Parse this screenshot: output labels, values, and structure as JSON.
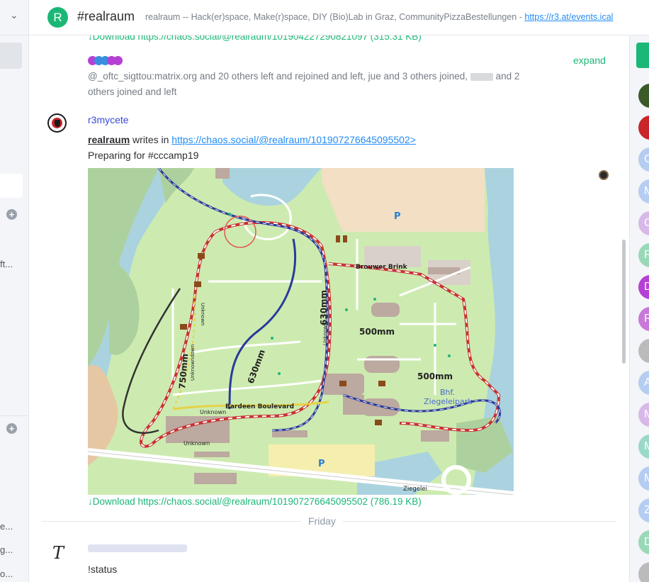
{
  "header": {
    "room_initial": "R",
    "room_name": "#realraum",
    "topic": "realraum -- Hack(er)space, Make(r)space, DIY (Bio)Lab in Graz, CommunityPizzaBestellungen - ",
    "topic_link": "https://r3.at/events.ical"
  },
  "left_panel": {
    "fragments": [
      "ft...",
      "e...",
      "g...",
      "o..."
    ]
  },
  "timeline": {
    "download_top": "↓Download https://chaos.social/@realraum/101904227290821097 (315.31 KB)",
    "expand_label": "expand",
    "membership_part1": "@_oftc_sigttou:matrix.org and 20 others left and rejoined and left, jue and 3 others joined, ",
    "membership_part2": "and 2 others joined and left",
    "pill_colors": [
      "#b640d6",
      "#3a8ee0",
      "#3a8ee0",
      "#b640d6",
      "#b640d6"
    ],
    "message": {
      "sender": "r3mycete",
      "quote_author": "realraum",
      "quote_writes": " writes in ",
      "quote_link": "https://chaos.social/@realraum/101907276645095502>",
      "body": "Preparing for #cccamp19",
      "download": "↓Download https://chaos.social/@realraum/101907276645095502 (786.19 KB)"
    },
    "map_labels": {
      "brouwer": "Brouwer Brink",
      "bardeen": "Bardeen Boulevard",
      "bhf": "Bhf.",
      "ziegeleipark": "Ziegeleipark",
      "ziegelei": "Ziegelei",
      "unknown": "Unknown",
      "unknowndown": "Unknowndown",
      "p": "P",
      "g630a": "630mm",
      "g630b": "630mm",
      "g500a": "500mm",
      "g500b": "500mm",
      "g750": "750mm"
    },
    "day_separator": "Friday",
    "message2": {
      "body": "!status"
    }
  },
  "right_panel": {
    "members": [
      {
        "initial": "",
        "color": "#3a5a2a"
      },
      {
        "initial": "",
        "color": "#c8262a"
      },
      {
        "initial": "C",
        "color": "#b5cdf0"
      },
      {
        "initial": "M",
        "color": "#b5cdf0"
      },
      {
        "initial": "C",
        "color": "#d8b8e8"
      },
      {
        "initial": "R",
        "color": "#9ad8b8"
      },
      {
        "initial": "D",
        "color": "#b640d6"
      },
      {
        "initial": "R",
        "color": "#c878d8"
      },
      {
        "initial": "",
        "color": "#bbbbbb"
      },
      {
        "initial": "A",
        "color": "#b5cdf0"
      },
      {
        "initial": "M",
        "color": "#d8b8e8"
      },
      {
        "initial": "M",
        "color": "#9ad8c8"
      },
      {
        "initial": "M",
        "color": "#b5cdf0"
      },
      {
        "initial": "Z",
        "color": "#b5cdf0"
      },
      {
        "initial": "D",
        "color": "#9ad8b8"
      },
      {
        "initial": "",
        "color": "#bbbbbb"
      }
    ]
  }
}
